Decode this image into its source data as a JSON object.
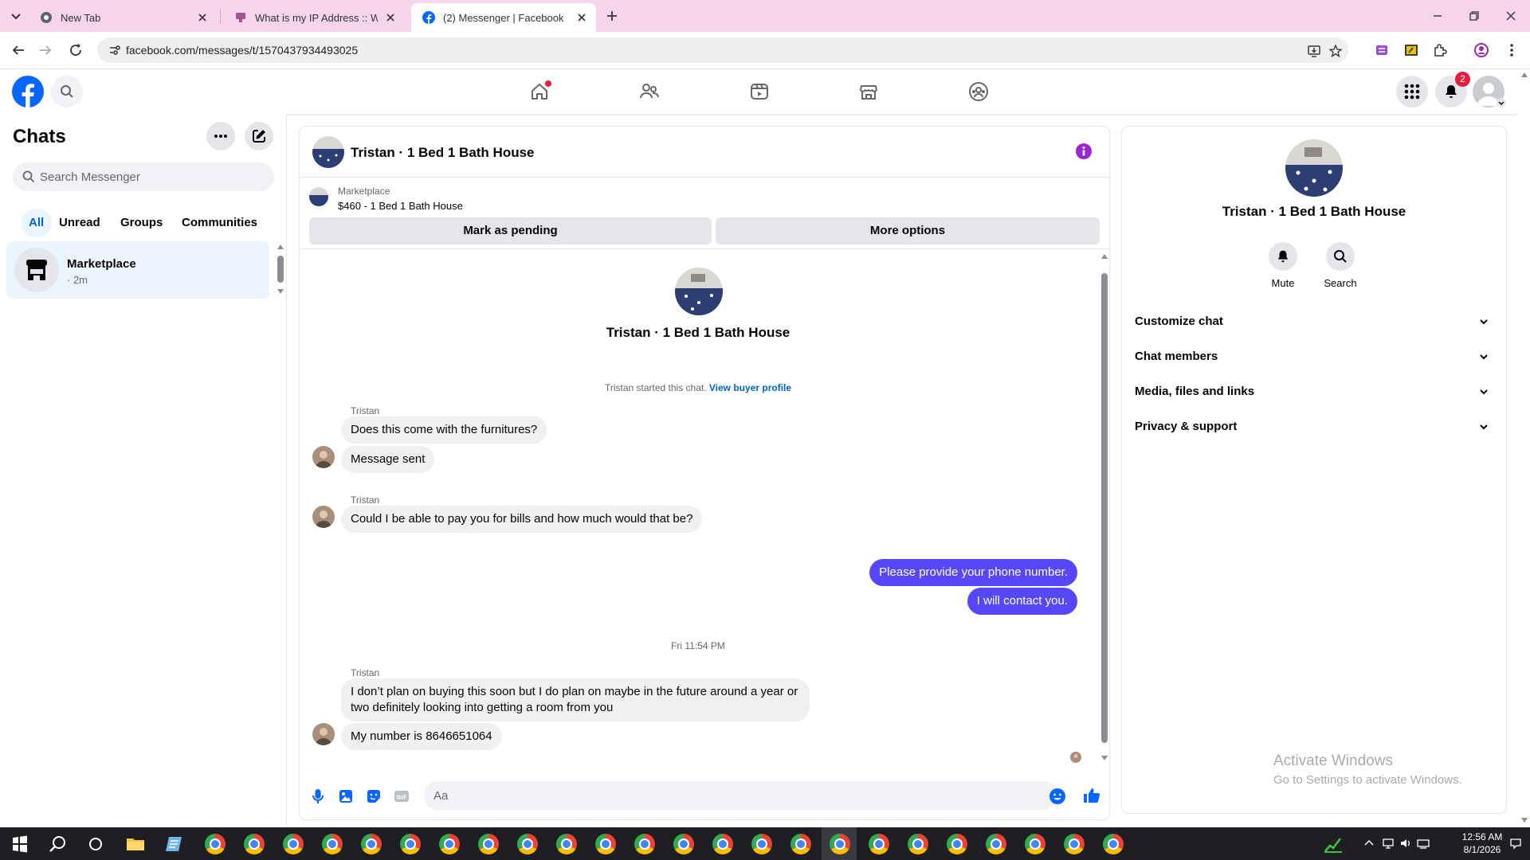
{
  "browser": {
    "tabs": [
      {
        "title": "New Tab",
        "icon": "chrome-icon",
        "active": false
      },
      {
        "title": "What is my IP Address :: WebBr",
        "icon": "webbrowser-tools-icon",
        "active": false
      },
      {
        "title": "(2) Messenger | Facebook",
        "icon": "facebook-icon",
        "active": true
      }
    ],
    "url": "facebook.com/messages/t/1570437934493025"
  },
  "fb": {
    "notification_count": "2",
    "nav_tabs": [
      "home-icon",
      "friends-icon",
      "video-icon",
      "marketplace-icon",
      "groups-icon"
    ]
  },
  "sidebar": {
    "title": "Chats",
    "search_placeholder": "Search Messenger",
    "filters": [
      "All",
      "Unread",
      "Groups",
      "Communities"
    ],
    "chats": [
      {
        "name": "Marketplace",
        "time": "· 2m"
      }
    ]
  },
  "conversation": {
    "title": "Tristan · 1 Bed 1 Bath House",
    "listing": {
      "label": "Marketplace",
      "price_title": "$460 - 1 Bed 1 Bath House",
      "buttons": [
        "Mark as pending",
        "More options"
      ]
    },
    "intro_name": "Tristan · 1 Bed 1 Bath House",
    "system_text": "Tristan started this chat.",
    "system_link": "View buyer profile",
    "messages": [
      {
        "sender": "Tristan",
        "text": "Does this come with the furnitures?",
        "dir": "in"
      },
      {
        "sender": "",
        "text": "Message sent",
        "dir": "in"
      },
      {
        "sender": "Tristan",
        "text": "Could I be able to pay you for bills and how much would that be?",
        "dir": "in"
      },
      {
        "sender": "",
        "text": "Please provide your phone number.",
        "dir": "out"
      },
      {
        "sender": "",
        "text": "I will contact you.",
        "dir": "out"
      },
      {
        "sender": "Tristan",
        "text": "I don’t plan on buying this soon but I do plan on maybe in the future around a year or two definitely looking into getting a room from you",
        "dir": "in"
      },
      {
        "sender": "",
        "text": "My number is 8646651064",
        "dir": "in"
      }
    ],
    "timestamp": "Fri 11:54 PM",
    "composer_placeholder": "Aa"
  },
  "info_panel": {
    "name": "Tristan · 1 Bed 1 Bath House",
    "actions": [
      "Mute",
      "Search"
    ],
    "sections": [
      "Customize chat",
      "Chat members",
      "Media, files and links",
      "Privacy & support"
    ]
  },
  "watermark": {
    "line1": "Activate Windows",
    "line2": "Go to Settings to activate Windows."
  },
  "taskbar": {
    "time": "12:56 AM",
    "date": "8/1/2026"
  },
  "colors": {
    "fb_blue": "#0866ff",
    "outgoing_bubble": "#5747fb",
    "active_filter": "#0064d1",
    "tab_bar": "#f6d4ec"
  }
}
